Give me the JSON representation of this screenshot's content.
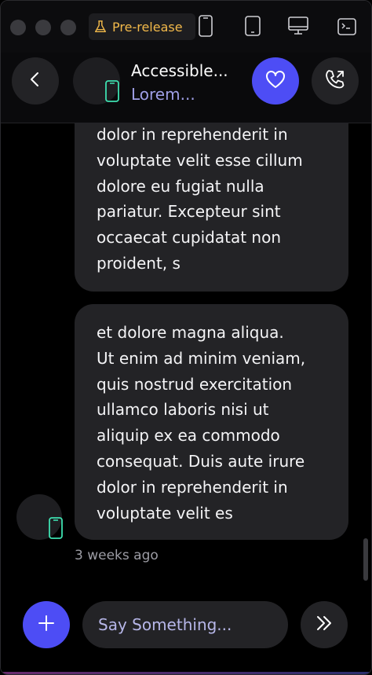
{
  "titlebar": {
    "release_label": "Pre-release",
    "icons": [
      "flask-icon",
      "phone-icon",
      "tablet-icon",
      "desktop-icon",
      "terminal-icon"
    ]
  },
  "header": {
    "title": "Accessible...",
    "subtitle": "Lorem...",
    "icons": [
      "back-chevron-icon",
      "heart-icon",
      "phone-call-icon"
    ]
  },
  "messages": [
    {
      "text": "dolor in reprehenderit in\nvoluptate velit esse cillum\ndolore eu fugiat nulla\npariatur. Excepteur sint\noccaecat cupidatat non\nproident, s"
    },
    {
      "text": "et dolore magna aliqua.\nUt enim ad minim veniam,\nquis nostrud exercitation\nullamco laboris nisi ut\naliquip ex ea commodo\nconsequat. Duis aute irure\ndolor in reprehenderit in\nvoluptate velit es"
    }
  ],
  "timestamp": "3 weeks ago",
  "composer": {
    "placeholder": "Say Something...",
    "icons": [
      "plus-icon",
      "double-chevron-right-icon"
    ]
  },
  "colors": {
    "accent": "#4d4df5",
    "release_label": "#f2b94a",
    "subtitle": "#9f9fe6",
    "bubble": "#232326",
    "device_icon_teal": "#3ee0b0"
  }
}
